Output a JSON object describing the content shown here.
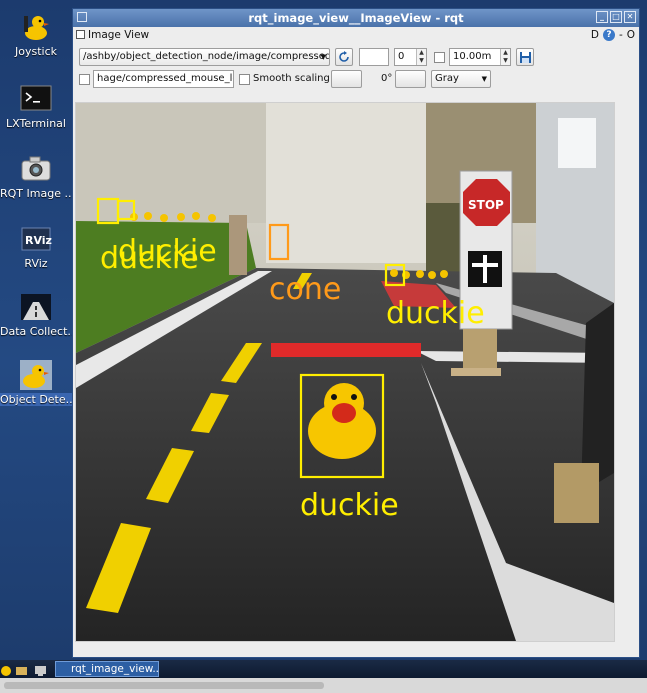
{
  "desktop": {
    "icons": [
      {
        "label": "Joystick",
        "icon": "joystick-duck-icon"
      },
      {
        "label": "LXTerminal",
        "icon": "terminal-icon"
      },
      {
        "label": "RQT Image ...",
        "icon": "camera-icon"
      },
      {
        "label": "RViz",
        "icon": "rviz-icon"
      },
      {
        "label": "Data Collect...",
        "icon": "road-icon"
      },
      {
        "label": "Object Dete...",
        "icon": "duck-icon"
      }
    ]
  },
  "window": {
    "title": "rqt_image_view__ImageView - rqt",
    "panel_title": "Image View",
    "panel_right_d": "D",
    "panel_right_help": "?",
    "panel_right_dash": "-",
    "panel_right_o": "O"
  },
  "toolbar": {
    "topic": "/ashby/object_detection_node/image/compressed",
    "refresh_icon": "refresh-icon",
    "blank_field_1": "",
    "spin_value": "0",
    "max_value": "10.00m",
    "save_icon": "save-icon",
    "mouse_topic": "hage/compressed_mouse_left",
    "smooth_scaling_label": "Smooth scaling",
    "smooth_scaling_checked": false,
    "blank_field_2": "",
    "rotation": "0°",
    "blank_field_3": "",
    "color_scheme": "Gray"
  },
  "image": {
    "detections": [
      {
        "label": "duckie",
        "color": "#ffee00"
      },
      {
        "label": "duckie",
        "color": "#ffee00"
      },
      {
        "label": "cone",
        "color": "#ff9a1a"
      },
      {
        "label": "duckie",
        "color": "#ffee00"
      },
      {
        "label": "duckie",
        "color": "#ffee00"
      }
    ],
    "sign_text": "STOP"
  },
  "taskbar": {
    "app_label": "rqt_image_view..."
  },
  "colors": {
    "desktop_bg": "#1f3f73",
    "titlebar": "#5a82b8",
    "detection_yellow": "#ffee00",
    "detection_orange": "#ff9a1a"
  }
}
